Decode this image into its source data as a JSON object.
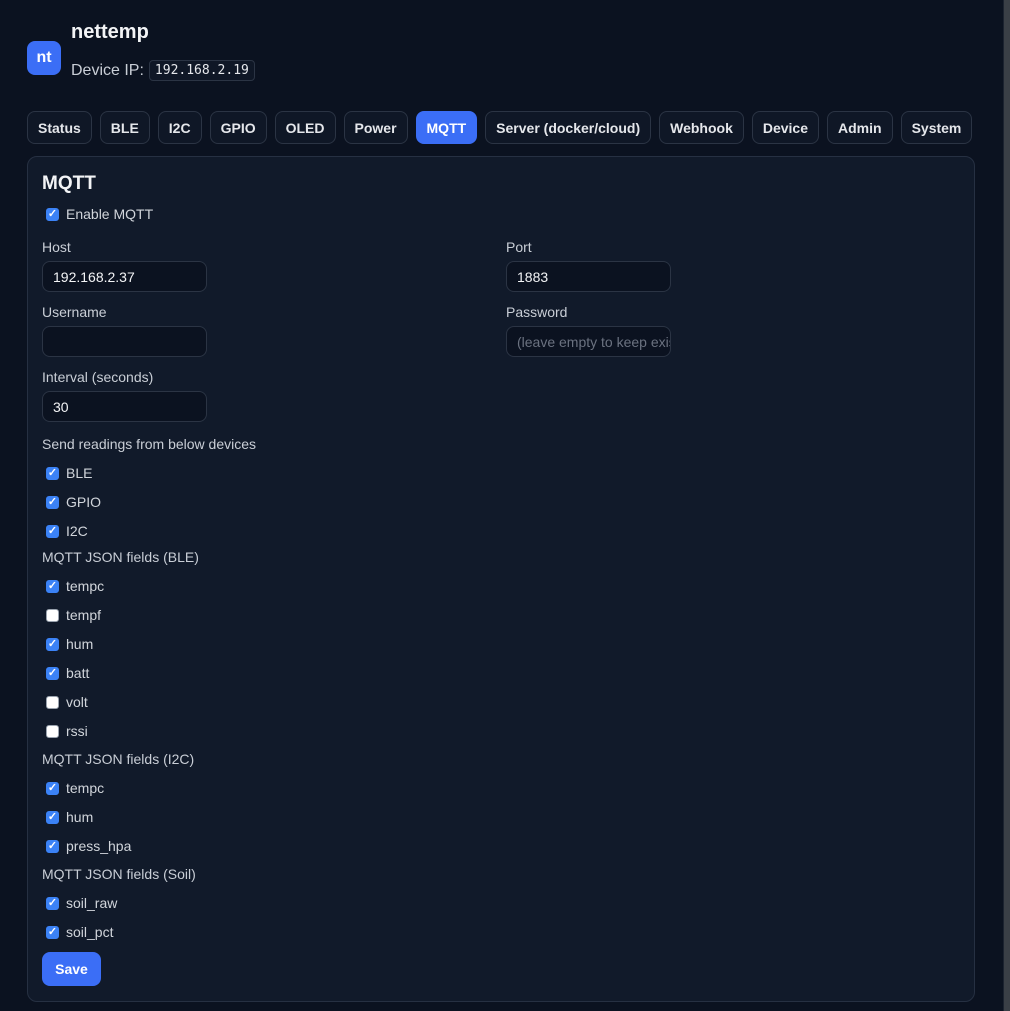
{
  "app": {
    "logo_text": "nt",
    "title": "nettemp",
    "ip_label": "Device IP:",
    "ip_value": "192.168.2.19"
  },
  "tabs": [
    {
      "label": "Status",
      "active": false
    },
    {
      "label": "BLE",
      "active": false
    },
    {
      "label": "I2C",
      "active": false
    },
    {
      "label": "GPIO",
      "active": false
    },
    {
      "label": "OLED",
      "active": false
    },
    {
      "label": "Power",
      "active": false
    },
    {
      "label": "MQTT",
      "active": true
    },
    {
      "label": "Server (docker/cloud)",
      "active": false
    },
    {
      "label": "Webhook",
      "active": false
    },
    {
      "label": "Device",
      "active": false
    },
    {
      "label": "Admin",
      "active": false
    },
    {
      "label": "System",
      "active": false
    }
  ],
  "mqtt": {
    "title": "MQTT",
    "enable": {
      "label": "Enable MQTT",
      "checked": true
    },
    "host": {
      "label": "Host",
      "value": "192.168.2.37"
    },
    "port": {
      "label": "Port",
      "value": "1883"
    },
    "username": {
      "label": "Username",
      "value": ""
    },
    "password": {
      "label": "Password",
      "placeholder": "(leave empty to keep existing)"
    },
    "interval": {
      "label": "Interval (seconds)",
      "value": "30"
    },
    "devices": {
      "label": "Send readings from below devices",
      "items": [
        {
          "label": "BLE",
          "checked": true
        },
        {
          "label": "GPIO",
          "checked": true
        },
        {
          "label": "I2C",
          "checked": true
        }
      ]
    },
    "ble_fields": {
      "label": "MQTT JSON fields (BLE)",
      "items": [
        {
          "label": "tempc",
          "checked": true
        },
        {
          "label": "tempf",
          "checked": false
        },
        {
          "label": "hum",
          "checked": true
        },
        {
          "label": "batt",
          "checked": true
        },
        {
          "label": "volt",
          "checked": false
        },
        {
          "label": "rssi",
          "checked": false
        }
      ]
    },
    "i2c_fields": {
      "label": "MQTT JSON fields (I2C)",
      "items": [
        {
          "label": "tempc",
          "checked": true
        },
        {
          "label": "hum",
          "checked": true
        },
        {
          "label": "press_hpa",
          "checked": true
        }
      ]
    },
    "soil_fields": {
      "label": "MQTT JSON fields (Soil)",
      "items": [
        {
          "label": "soil_raw",
          "checked": true
        },
        {
          "label": "soil_pct",
          "checked": true
        }
      ]
    },
    "save_label": "Save"
  },
  "colors": {
    "accent": "#3b6ef6",
    "background": "#0b1220",
    "panel": "#111a2a",
    "checkbox": "#3b82f6"
  },
  "icons": {
    "checkmark": "check-icon"
  }
}
